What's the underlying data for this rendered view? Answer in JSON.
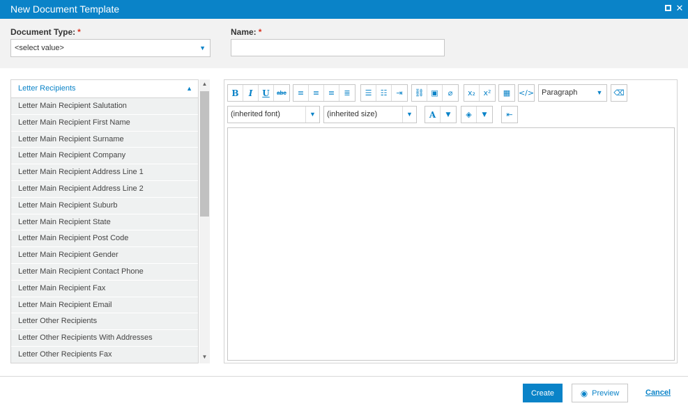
{
  "window": {
    "title": "New Document Template"
  },
  "form": {
    "document_type_label": "Document Type:",
    "document_type_value": "<select value>",
    "name_label": "Name:",
    "name_value": "",
    "required_mark": "*"
  },
  "fields_panel": {
    "group_title": "Letter Recipients",
    "items": [
      "Letter Main Recipient Salutation",
      "Letter Main Recipient First Name",
      "Letter Main Recipient Surname",
      "Letter Main Recipient Company",
      "Letter Main Recipient Address Line 1",
      "Letter Main Recipient Address Line 2",
      "Letter Main Recipient Suburb",
      "Letter Main Recipient State",
      "Letter Main Recipient Post Code",
      "Letter Main Recipient Gender",
      "Letter Main Recipient Contact Phone",
      "Letter Main Recipient Fax",
      "Letter Main Recipient Email",
      "Letter Other Recipients",
      "Letter Other Recipients With Addresses",
      "Letter Other Recipients Fax"
    ]
  },
  "editor": {
    "toolbar": {
      "bold": "B",
      "italic": "I",
      "underline": "U",
      "strikethrough": "abc",
      "format_value": "Paragraph",
      "font_value": "(inherited font)",
      "size_value": "(inherited size)",
      "font_color_glyph": "A"
    },
    "content": ""
  },
  "footer": {
    "create_label": "Create",
    "preview_label": "Preview",
    "cancel_label": "Cancel"
  },
  "colors": {
    "accent": "#0a83c8",
    "required": "#d9321f",
    "panel_bg": "#f2f2f2",
    "list_item_bg": "#eff1f1"
  }
}
